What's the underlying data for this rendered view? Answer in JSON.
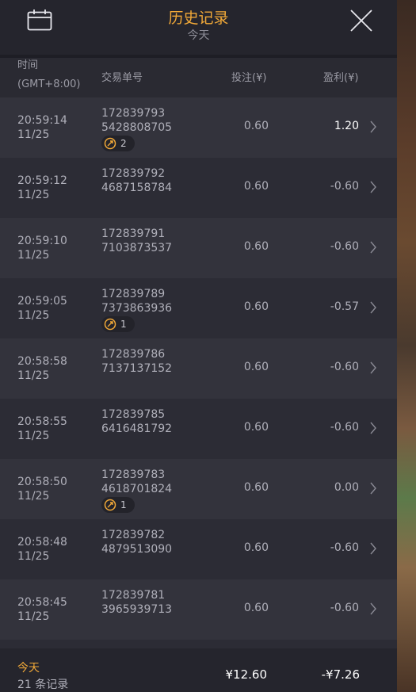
{
  "header": {
    "title": "历史记录",
    "subtitle": "今天"
  },
  "columns": {
    "time": "时间",
    "timezone": "(GMT+8:00)",
    "transaction_id": "交易单号",
    "bet": "投注(¥)",
    "profit": "盈利(¥)"
  },
  "rows": [
    {
      "time": "20:59:14",
      "date": "11/25",
      "id_line1": "172839793",
      "id_line2": "5428808705",
      "badge": "2",
      "bet": "0.60",
      "profit": "1.20"
    },
    {
      "time": "20:59:12",
      "date": "11/25",
      "id_line1": "172839792",
      "id_line2": "4687158784",
      "badge": null,
      "bet": "0.60",
      "profit": "-0.60"
    },
    {
      "time": "20:59:10",
      "date": "11/25",
      "id_line1": "172839791",
      "id_line2": "7103873537",
      "badge": null,
      "bet": "0.60",
      "profit": "-0.60"
    },
    {
      "time": "20:59:05",
      "date": "11/25",
      "id_line1": "172839789",
      "id_line2": "7373863936",
      "badge": "1",
      "bet": "0.60",
      "profit": "-0.57"
    },
    {
      "time": "20:58:58",
      "date": "11/25",
      "id_line1": "172839786",
      "id_line2": "7137137152",
      "badge": null,
      "bet": "0.60",
      "profit": "-0.60"
    },
    {
      "time": "20:58:55",
      "date": "11/25",
      "id_line1": "172839785",
      "id_line2": "6416481792",
      "badge": null,
      "bet": "0.60",
      "profit": "-0.60"
    },
    {
      "time": "20:58:50",
      "date": "11/25",
      "id_line1": "172839783",
      "id_line2": "4618701824",
      "badge": "1",
      "bet": "0.60",
      "profit": "0.00"
    },
    {
      "time": "20:58:48",
      "date": "11/25",
      "id_line1": "172839782",
      "id_line2": "4879513090",
      "badge": null,
      "bet": "0.60",
      "profit": "-0.60"
    },
    {
      "time": "20:58:45",
      "date": "11/25",
      "id_line1": "172839781",
      "id_line2": "3965939713",
      "badge": null,
      "bet": "0.60",
      "profit": "-0.60"
    }
  ],
  "footer": {
    "today": "今天",
    "count": "21 条记录",
    "total_bet": "¥12.60",
    "total_profit": "-¥7.26"
  },
  "colors": {
    "accent": "#f0a838",
    "panel": "#2c2c35",
    "row_alt": "#33333c"
  },
  "icons": {
    "calendar": "calendar-icon",
    "close": "close-icon",
    "chevron": "chevron-right-icon",
    "free_spin": "free-spin-icon"
  }
}
